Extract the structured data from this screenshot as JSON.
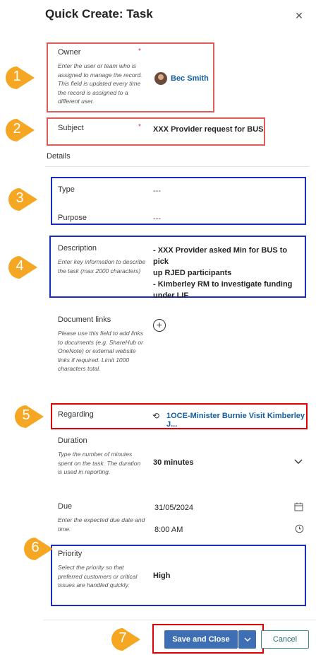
{
  "dialog": {
    "title": "Quick Create: Task",
    "close_icon": "close-icon"
  },
  "owner": {
    "label": "Owner",
    "required": "*",
    "hint": "Enter the user or team who is assigned to manage the record. This field is updated every time the record is assigned to a different user.",
    "value": "Bec Smith"
  },
  "subject": {
    "label": "Subject",
    "required": "*",
    "value": "XXX Provider request for BUS"
  },
  "details": {
    "heading": "Details"
  },
  "type": {
    "label": "Type",
    "value": "---"
  },
  "purpose": {
    "label": "Purpose",
    "value": "---"
  },
  "description": {
    "label": "Description",
    "hint": "Enter key information to describe the task (max 2000 characters)",
    "lines": [
      "- XXX Provider asked Min for BUS to pick",
      "up RJED participants",
      "- Kimberley RM to investigate funding",
      "under LIF"
    ]
  },
  "document_links": {
    "label": "Document links",
    "hint": "Please use this field to add links to documents (e.g. ShareHub or OneNote) or external website links if required. Limit 1000 characters total."
  },
  "regarding": {
    "label": "Regarding",
    "value": "1OCE-Minister Burnie Visit Kimberley J..."
  },
  "duration": {
    "label": "Duration",
    "hint": "Type the number of minutes spent on the task. The duration is used in reporting.",
    "value": "30 minutes"
  },
  "due": {
    "label": "Due",
    "hint": "Enter the expected due date and time.",
    "date": "31/05/2024",
    "time": "8:00 AM"
  },
  "priority": {
    "label": "Priority",
    "hint": "Select the priority so that preferred customers or critical issues are handled quickly.",
    "value": "High"
  },
  "footer": {
    "save_label": "Save and Close",
    "cancel_label": "Cancel"
  },
  "markers": [
    "1",
    "2",
    "3",
    "4",
    "5",
    "6",
    "7"
  ],
  "colors": {
    "accent": "#3e6fb5",
    "link": "#115ea3",
    "marker": "#f5a623",
    "highlight_red": "#e05a5a",
    "highlight_blue": "#1a2dbd"
  }
}
